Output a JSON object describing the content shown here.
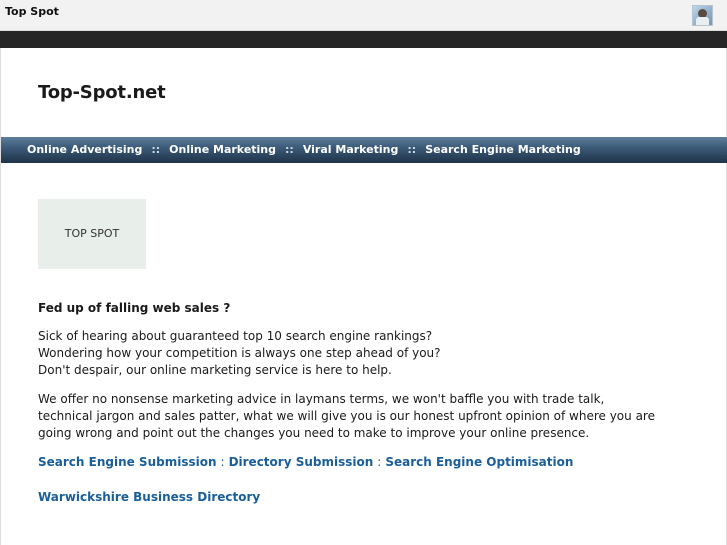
{
  "topbar": {
    "brand": "Top Spot",
    "avatar_icon": "user-avatar-icon"
  },
  "site": {
    "title": "Top-Spot.net"
  },
  "nav": {
    "items": [
      "Online Advertising",
      "Online Marketing",
      "Viral Marketing",
      "Search Engine Marketing"
    ],
    "separator": "::"
  },
  "logo": {
    "text": "TOP SPOT"
  },
  "content": {
    "heading": "Fed up of falling web sales ?",
    "para1_line1": "Sick of hearing about guaranteed top 10 search engine rankings?",
    "para1_line2": "Wondering how your competition is always one step ahead of you?",
    "para1_line3": "Don't despair, our online marketing service is here to help.",
    "para2": "We offer no nonsense marketing advice in laymans terms, we won't baffle you with trade talk, technical jargon and sales patter, what we will give you is our honest upfront opinion of where you are going wrong and point out the changes you need to make to improve your online presence."
  },
  "links": {
    "items": [
      "Search Engine Submission",
      "Directory Submission",
      "Search Engine Optimisation"
    ],
    "separator": ":",
    "directory": "Warwickshire Business Directory"
  },
  "colors": {
    "nav_bg": "#2d4660",
    "link": "#1a5e9a",
    "dark_bar": "#262626"
  }
}
